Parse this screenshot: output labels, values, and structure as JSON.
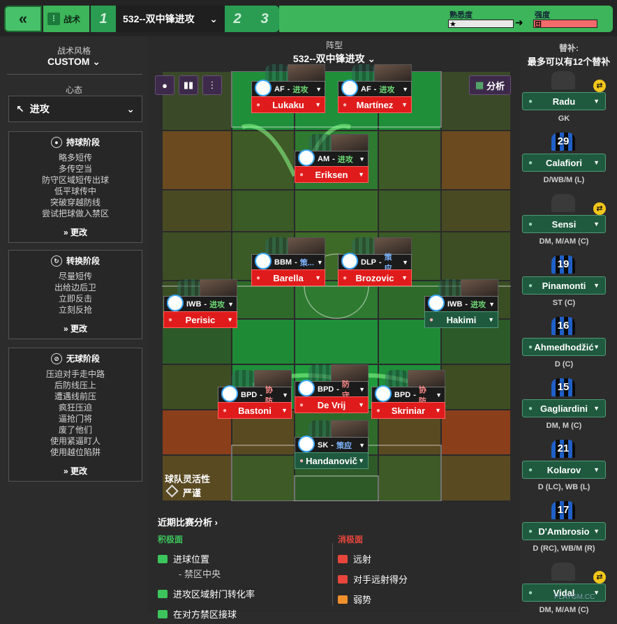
{
  "topbar": {
    "back_icon": "«",
    "tactic_label": "战术",
    "slot1": "1",
    "slot_name": "532--双中锋进攻",
    "slot2": "2",
    "slot3": "3",
    "familiarity_label": "熟悉度",
    "strength_label": "强度"
  },
  "left": {
    "style_caption": "战术风格",
    "style_value": "CUSTOM",
    "mentality_caption": "心态",
    "mentality_value": "进攻",
    "phases": [
      {
        "title": "持球阶段",
        "items": [
          "略多短传",
          "多传空当",
          "防守区域短传出球",
          "低平球传中",
          "突破穿越防线",
          "尝试把球做入禁区"
        ],
        "button": "更改"
      },
      {
        "title": "转换阶段",
        "items": [
          "尽量短传",
          "出给边后卫",
          "立即反击",
          "立刻反抢"
        ],
        "button": "更改"
      },
      {
        "title": "无球阶段",
        "items": [
          "压迫对手走中路",
          "后防线压上",
          "遭遇线前压",
          "疯狂压迫",
          "逼抢门将",
          "废了他们",
          "使用紧逼盯人",
          "使用越位陷阱"
        ],
        "button": "更改"
      }
    ]
  },
  "pitch": {
    "formation_caption": "阵型",
    "formation_name": "532--双中锋进攻",
    "analyse_label": "分析",
    "fluidity_caption": "球队灵活性",
    "fluidity_value": "严谨",
    "players": [
      {
        "role": "AF",
        "duty": "进攻",
        "name": "Lukaku",
        "duty_color": "#6fdc76"
      },
      {
        "role": "AF",
        "duty": "进攻",
        "name": "Martínez",
        "duty_color": "#6fdc76"
      },
      {
        "role": "AM",
        "duty": "进攻",
        "name": "Eriksen",
        "duty_color": "#6fdc76"
      },
      {
        "role": "BBM",
        "duty": "策...",
        "name": "Barella",
        "duty_color": "#7fb7ff"
      },
      {
        "role": "DLP",
        "duty": "策应",
        "name": "Brozovic",
        "duty_color": "#7fb7ff"
      },
      {
        "role": "IWB",
        "duty": "进攻",
        "name": "Perisic",
        "duty_color": "#6fdc76"
      },
      {
        "role": "IWB",
        "duty": "进攻",
        "name": "Hakimi",
        "duty_color": "#6fdc76"
      },
      {
        "role": "BPD",
        "duty": "协防",
        "name": "Bastoni",
        "duty_color": "#ff8a8a"
      },
      {
        "role": "BPD",
        "duty": "防守",
        "name": "De Vrij",
        "duty_color": "#ff8a8a"
      },
      {
        "role": "BPD",
        "duty": "协防",
        "name": "Skriniar",
        "duty_color": "#ff8a8a"
      },
      {
        "role": "SK",
        "duty": "策应",
        "name": "Handanovič",
        "duty_color": "#7fb7ff"
      }
    ]
  },
  "analysis": {
    "title": "近期比赛分析",
    "positive_caption": "积极面",
    "negative_caption": "消极面",
    "positives": [
      "进球位置",
      "- 禁区中央",
      "进攻区域射门转化率",
      "在对方禁区接球"
    ],
    "negatives": [
      "远射",
      "对手远射得分",
      "弱势"
    ],
    "colors": {
      "positive": "#3cc55c",
      "negative": "#e8453c",
      "warn": "#f0902a"
    }
  },
  "subs": {
    "caption": "替补:",
    "max_text": "最多可以有12个替补",
    "players": [
      {
        "number": "",
        "name": "Radu",
        "pos": "GK",
        "swap": true
      },
      {
        "number": "29",
        "name": "Calafiori",
        "pos": "D/WB/M (L)",
        "swap": false
      },
      {
        "number": "",
        "name": "Sensi",
        "pos": "DM, M/AM (C)",
        "swap": true
      },
      {
        "number": "19",
        "name": "Pinamonti",
        "pos": "ST (C)",
        "swap": false
      },
      {
        "number": "16",
        "name": "Ahmedhodžić",
        "pos": "D (C)",
        "swap": false
      },
      {
        "number": "15",
        "name": "Gagliardini",
        "pos": "DM, M (C)",
        "swap": false
      },
      {
        "number": "21",
        "name": "Kolarov",
        "pos": "D (LC), WB (L)",
        "swap": false
      },
      {
        "number": "17",
        "name": "D'Ambrosio",
        "pos": "D (RC), WB/M (R)",
        "swap": false
      },
      {
        "number": "",
        "name": "Vidal",
        "pos": "DM, M/AM (C)",
        "swap": true
      }
    ]
  },
  "watermark": "PLAYGM.CC"
}
